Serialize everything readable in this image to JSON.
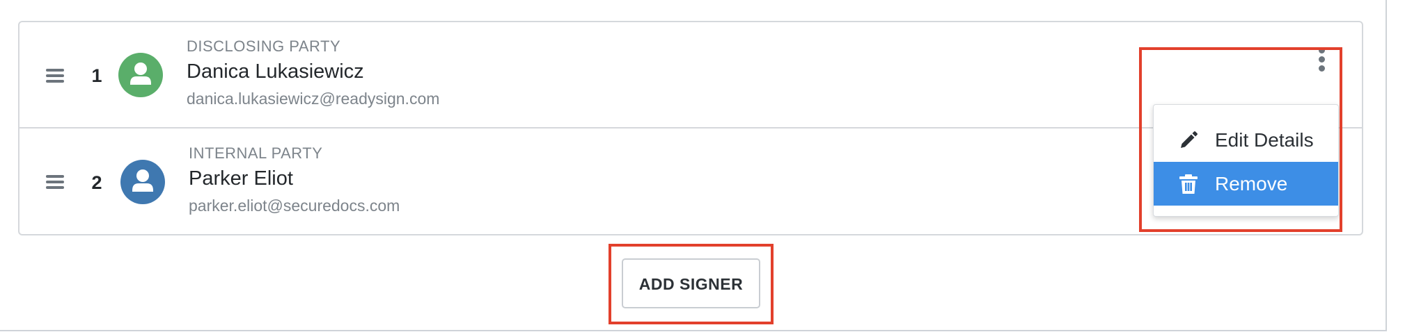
{
  "signers": [
    {
      "order": "1",
      "party_type": "DISCLOSING PARTY",
      "name": "Danica Lukasiewicz",
      "email": "danica.lukasiewicz@readysign.com",
      "avatar_color": "#5aae6a",
      "avatar_icon": "user-icon"
    },
    {
      "order": "2",
      "party_type": "INTERNAL PARTY",
      "name": "Parker Eliot",
      "email": "parker.eliot@securedocs.com",
      "avatar_color": "#3f78b0",
      "avatar_icon": "user-icon"
    }
  ],
  "row_menu": {
    "trigger_icon": "kebab-menu-icon",
    "items": [
      {
        "label": "Edit Details",
        "icon": "pencil-icon"
      },
      {
        "label": "Remove",
        "icon": "trash-icon",
        "highlighted": true
      }
    ],
    "highlight_color": "#3d8ee6"
  },
  "add_signer": {
    "label": "ADD SIGNER"
  },
  "annotation_color": "#e2402c"
}
